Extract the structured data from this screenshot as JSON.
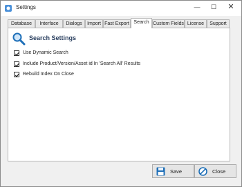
{
  "window": {
    "title": "Settings"
  },
  "titlebar": {
    "minimize": "—",
    "maximize": "☐",
    "close": "✕"
  },
  "tabs": [
    {
      "label": "Database",
      "active": false
    },
    {
      "label": "Interface",
      "active": false
    },
    {
      "label": "Dialogs",
      "active": false
    },
    {
      "label": "Import",
      "active": false
    },
    {
      "label": "Fast Export",
      "active": false
    },
    {
      "label": "Search",
      "active": true
    },
    {
      "label": "Custom Fields",
      "active": false
    },
    {
      "label": "License",
      "active": false
    },
    {
      "label": "Support",
      "active": false
    }
  ],
  "section": {
    "title": "Search Settings",
    "icon": "magnifier-icon"
  },
  "options": [
    {
      "label": "Use Dynamic Search",
      "checked": true
    },
    {
      "label": "Include Product/Version/Asset id In 'Search All' Results",
      "checked": true
    },
    {
      "label": "Rebuild Index On Close",
      "checked": true
    }
  ],
  "buttons": {
    "save": "Save",
    "close": "Close"
  },
  "colors": {
    "accent": "#1e6fb8",
    "title_text": "#2a3f5f"
  }
}
